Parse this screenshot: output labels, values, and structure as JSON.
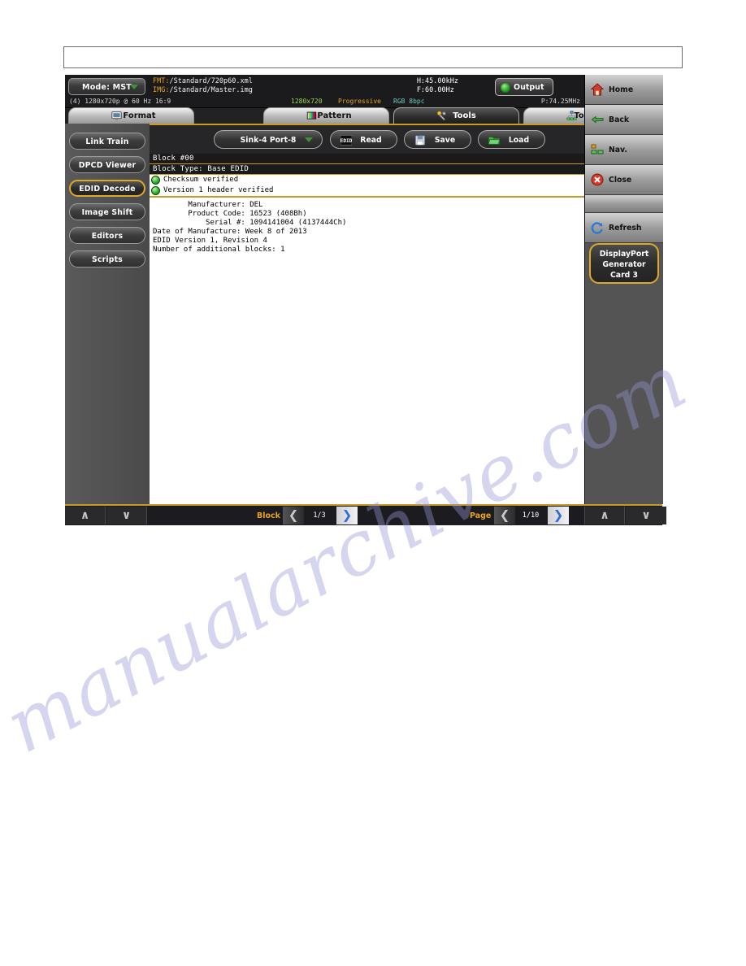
{
  "device": {
    "topbar": {
      "mode_button": "Mode: MST",
      "fmt_label": "FMT:",
      "fmt_value": "/Standard/720p60.xml",
      "img_label": "IMG:",
      "img_value": "/Standard/Master.img",
      "h_freq": "H:45.00kHz",
      "v_freq": "F:60.00Hz",
      "output_button": "Output"
    },
    "statusline": {
      "resolution_desc": "(4) 1280x720p @ 60 Hz 16:9",
      "resolution": "1280x720",
      "scan": "Progressive",
      "color": "RGB 8bpc",
      "pixel_clock": "P:74.25MHz"
    },
    "tabs": [
      {
        "label": "Format",
        "icon": "monitor-icon",
        "active": false
      },
      {
        "label": "Pattern",
        "icon": "colorbars-icon",
        "active": false
      },
      {
        "label": "Tools",
        "icon": "wrench-icon",
        "active": true
      },
      {
        "label": "Topology",
        "icon": "network-icon",
        "active": false
      }
    ],
    "left_menu": [
      {
        "label": "Link Train",
        "selected": false
      },
      {
        "label": "DPCD Viewer",
        "selected": false
      },
      {
        "label": "EDID Decode",
        "selected": true
      },
      {
        "label": "Image Shift",
        "selected": false
      },
      {
        "label": "Editors",
        "selected": false
      },
      {
        "label": "Scripts",
        "selected": false
      }
    ],
    "toolbar": {
      "sink_select": "Sink-4 Port-8",
      "read_button": "Read",
      "read_icon_text": "EDID",
      "save_button": "Save",
      "load_button": "Load"
    },
    "edid": {
      "block_header": "Block #00",
      "block_type": "Block Type: Base EDID",
      "verifications": [
        "Checksum verified",
        "Version 1 header verified"
      ],
      "details": "        Manufacturer: DEL\n        Product Code: 16523 (408Bh)\n            Serial #: 1094141004 (4137444Ch)\nDate of Manufacture: Week 8 of 2013\nEDID Version 1, Revision 4\nNumber of additional blocks: 1"
    },
    "right_menu": [
      {
        "label": "Home",
        "icon": "home-icon"
      },
      {
        "label": "Back",
        "icon": "back-arrow-icon"
      },
      {
        "label": "Nav.",
        "icon": "sitemap-icon"
      },
      {
        "label": "Close",
        "icon": "close-circle-icon"
      },
      {
        "label": "",
        "icon": "none"
      },
      {
        "label": "Refresh",
        "icon": "refresh-icon"
      }
    ],
    "card_button": {
      "line1": "DisplayPort",
      "line2": "Generator",
      "line3": "Card 3"
    },
    "bottombar": {
      "block_label": "Block",
      "block_count": "1/3",
      "page_label": "Page",
      "page_count": "1/10",
      "scroll_up": "∧",
      "scroll_down": "∨",
      "prev_arrow": "❮",
      "next_arrow": "❯"
    },
    "colors": {
      "accent_gold": "#c89b25",
      "status_green": "#2aa52a",
      "label_orange": "#e8a41c",
      "value_green": "#9cd64a",
      "value_cyan": "#6fc9c0",
      "next_arrow_blue": "#2a6fd6"
    }
  },
  "page": {
    "watermark": "manualarchive.com"
  }
}
